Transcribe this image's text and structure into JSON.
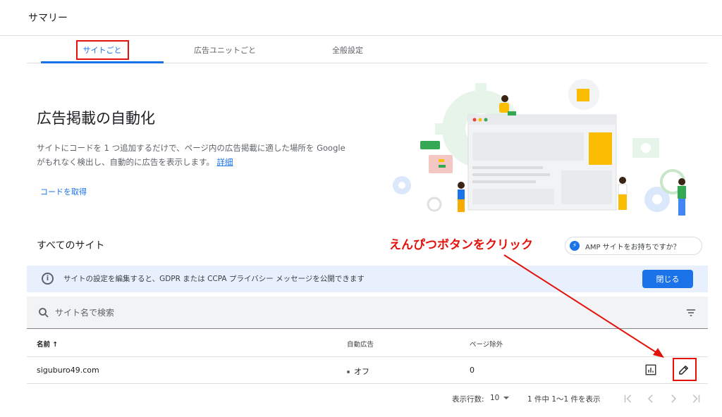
{
  "header": {
    "title": "サマリー"
  },
  "tabs": [
    {
      "label": "サイトごと",
      "active": true
    },
    {
      "label": "広告ユニットごと",
      "active": false
    },
    {
      "label": "全般設定",
      "active": false
    }
  ],
  "hero": {
    "title": "広告掲載の自動化",
    "description_line1": "サイトにコードを 1 つ追加するだけで、ページ内の広告掲載に適した場所を Google",
    "description_line2": "がもれなく検出し、自動的に広告を表示します。",
    "details_link": "詳細",
    "get_code_link": "コードを取得"
  },
  "section": {
    "title": "すべてのサイト",
    "amp_button": "AMP サイトをお持ちですか？"
  },
  "annotation": {
    "text": "えんぴつボタンをクリック"
  },
  "banner": {
    "text": "サイトの設定を編集すると、GDPR または CCPA プライバシー メッセージを公開できます",
    "close_label": "閉じる"
  },
  "search": {
    "placeholder": "サイト名で検索"
  },
  "table": {
    "columns": {
      "name": "名前 ↑",
      "auto_ads": "自動広告",
      "page_exclusions": "ページ除外"
    },
    "rows": [
      {
        "name": "siguburo49.com",
        "auto_ads": "オフ",
        "page_exclusions": "0"
      }
    ]
  },
  "pagination": {
    "rows_label": "表示行数:",
    "rows_value": "10",
    "range_text": "1 件中 1〜1 件を表示"
  },
  "colors": {
    "accent": "#1a73e8",
    "annotation_red": "#e3120b",
    "banner_bg": "#e8f0fe",
    "search_bg": "#f1f3f4"
  },
  "icons": [
    "info-icon",
    "search-icon",
    "filter-icon",
    "report-icon",
    "pencil-icon",
    "first-page-icon",
    "prev-page-icon",
    "next-page-icon",
    "last-page-icon",
    "amp-lightning-icon"
  ]
}
